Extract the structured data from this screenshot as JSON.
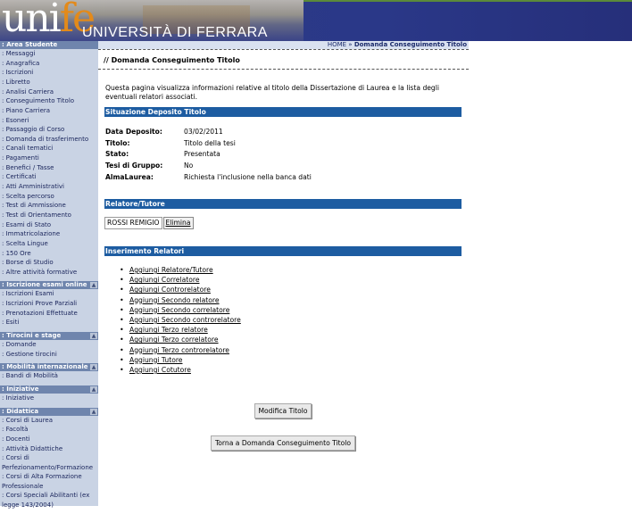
{
  "header": {
    "logo_uni": "uni",
    "logo_fe": "fe",
    "university_name": "UNIVERSITÀ DI FERRARA"
  },
  "sidebar": {
    "sections": [
      {
        "title": ": Area Studente",
        "toggle": "",
        "items": [
          ":  Messaggi",
          ":  Anagrafica",
          ":  Iscrizioni",
          ":  Libretto",
          ":  Analisi Carriera",
          ":  Conseguimento Titolo",
          ":  Piano Carriera",
          ":  Esoneri",
          ":  Passaggio di Corso",
          ":  Domanda di trasferimento",
          ":  Canali tematici",
          ":  Pagamenti",
          ":  Benefici / Tasse",
          ":  Certificati",
          ":  Atti Amministrativi",
          ":  Scelta percorso",
          ":  Test di Ammissione",
          ":  Test di Orientamento",
          ":  Esami di Stato",
          ":  Immatricolazione",
          ":  Scelta Lingue",
          ":  150 Ore",
          ":  Borse di Studio",
          ":  Altre attività formative"
        ]
      },
      {
        "title": ": Iscrizione esami online",
        "toggle": "▲",
        "items": [
          ":  Iscrizioni Esami",
          ":  Iscrizioni Prove Parziali",
          ":  Prenotazioni Effettuate",
          ":  Esiti"
        ]
      },
      {
        "title": ": Tirocini e stage",
        "toggle": "▲",
        "items": [
          ":  Domande",
          ":  Gestione tirocini"
        ]
      },
      {
        "title": ": Mobilità internazionale",
        "toggle": "▲",
        "items": [
          ":  Bandi di Mobilità"
        ]
      },
      {
        "title": ": Iniziative",
        "toggle": "▲",
        "items": [
          ":  Iniziative"
        ]
      },
      {
        "title": ": Didattica",
        "toggle": "▲",
        "items": [
          ":  Corsi di Laurea",
          ":  Facoltà",
          ":  Docenti",
          ":  Attività Didattiche",
          ":  Corsi di Perfezionamento/Formazione",
          ":  Corsi di Alta Formazione Professionale",
          ":  Corsi Speciali Abilitanti (ex legge 143/2004)"
        ]
      }
    ]
  },
  "breadcrumb": {
    "home": "HOME",
    "separator": " » ",
    "current": "Domanda Conseguimento Titolo"
  },
  "page_title": "// Domanda Conseguimento Titolo",
  "intro_text": "Questa pagina visualizza informazioni relative al titolo della Dissertazione di Laurea e la lista degli eventuali relatori associati.",
  "deposito": {
    "heading": "Situazione Deposito Titolo",
    "rows": [
      {
        "label": "Data Deposito:",
        "value": "03/02/2011"
      },
      {
        "label": "Titolo:",
        "value": "Titolo della tesi"
      },
      {
        "label": "Stato:",
        "value": "Presentata"
      },
      {
        "label": "Tesi di Gruppo:",
        "value": "No"
      },
      {
        "label": "AlmaLaurea:",
        "value": "Richiesta l'inclusione nella banca dati"
      }
    ]
  },
  "relatore": {
    "heading": "Relatore/Tutore",
    "name": "ROSSI REMIGIO",
    "delete_label": "Elimina"
  },
  "inserimento": {
    "heading": "Inserimento Relatori",
    "links": [
      "Aggiungi Relatore/Tutore",
      "Aggiungi Correlatore",
      "Aggiungi Controrelatore",
      "Aggiungi Secondo relatore",
      "Aggiungi Secondo correlatore",
      "Aggiungi Secondo controrelatore",
      "Aggiungi Terzo relatore",
      "Aggiungi Terzo correlatore",
      "Aggiungi Terzo controrelatore",
      "Aggiungi Tutore",
      "Aggiungi Cotutore"
    ]
  },
  "buttons": {
    "modifica": "Modifica Titolo",
    "torna": "Torna a Domanda Conseguimento Titolo"
  },
  "colors": {
    "section_bar": "#1d5ca1",
    "sidebar_bg": "#c9d3e4",
    "sidebar_head": "#6f85ad",
    "logo_accent": "#e38a1a"
  }
}
